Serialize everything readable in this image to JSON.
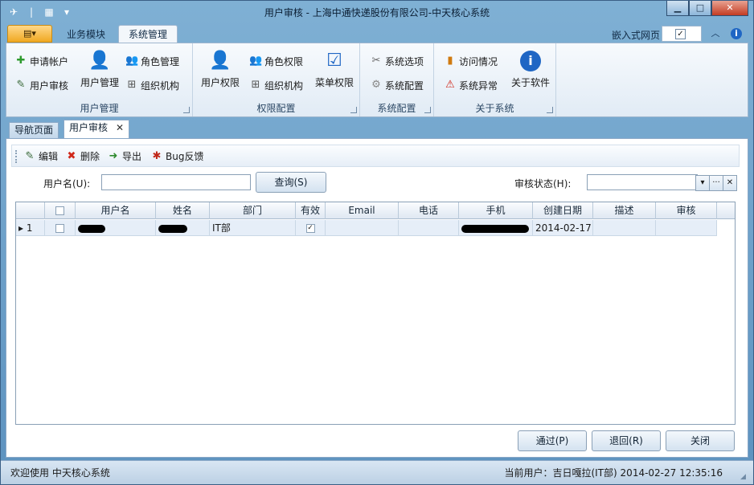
{
  "window": {
    "title": "用户审核 - 上海中通快递股份有限公司-中天核心系统",
    "minimize": "▁",
    "maximize": "□",
    "close": "✕"
  },
  "ribbon_tabs": {
    "app_button": "▤▾",
    "tabs": [
      "业务模块",
      "系统管理"
    ],
    "embed_label": "嵌入式网页",
    "embed_checked": "✓",
    "collapse": "︿",
    "help": "i"
  },
  "ribbon": {
    "groups": [
      {
        "title": "用户管理",
        "apply_account": "申请帐户",
        "user_audit": "用户审核",
        "user_manage": "用户管理",
        "role_manage": "角色管理",
        "org": "组织机构"
      },
      {
        "title": "权限配置",
        "user_perm": "用户权限",
        "role_perm": "角色权限",
        "org": "组织机构",
        "menu_perm": "菜单权限"
      },
      {
        "title": "系统配置",
        "options": "系统选项",
        "config": "系统配置"
      },
      {
        "title": "关于系统",
        "visits": "访问情况",
        "exceptions": "系统异常",
        "about": "关于软件"
      }
    ]
  },
  "doc_tabs": {
    "nav": "导航页面",
    "audit": "用户审核",
    "close": "✕"
  },
  "toolbar": {
    "edit": "编辑",
    "delete": "删除",
    "export": "导出",
    "bug": "Bug反馈"
  },
  "filter": {
    "username_label": "用户名(U):",
    "username_value": "",
    "query_button": "查询(S)",
    "status_label": "审核状态(H):",
    "status_value": "",
    "dropdown": "▾",
    "more": "···",
    "clear": "✕"
  },
  "grid": {
    "headers": [
      "",
      "用户名",
      "姓名",
      "部门",
      "有效",
      "Email",
      "电话",
      "手机",
      "创建日期",
      "描述",
      "审核"
    ],
    "rows": [
      {
        "indicator": "▸",
        "num": "1",
        "dept": "IT部",
        "valid": "✓",
        "created": "2014-02-17"
      }
    ]
  },
  "footer_buttons": {
    "approve": "通过(P)",
    "reject": "退回(R)",
    "close": "关闭"
  },
  "statusbar": {
    "welcome": "欢迎使用 中天核心系统",
    "current_user": "当前用户：吉日嘎拉(IT部)  2014-02-27 12:35:16"
  }
}
